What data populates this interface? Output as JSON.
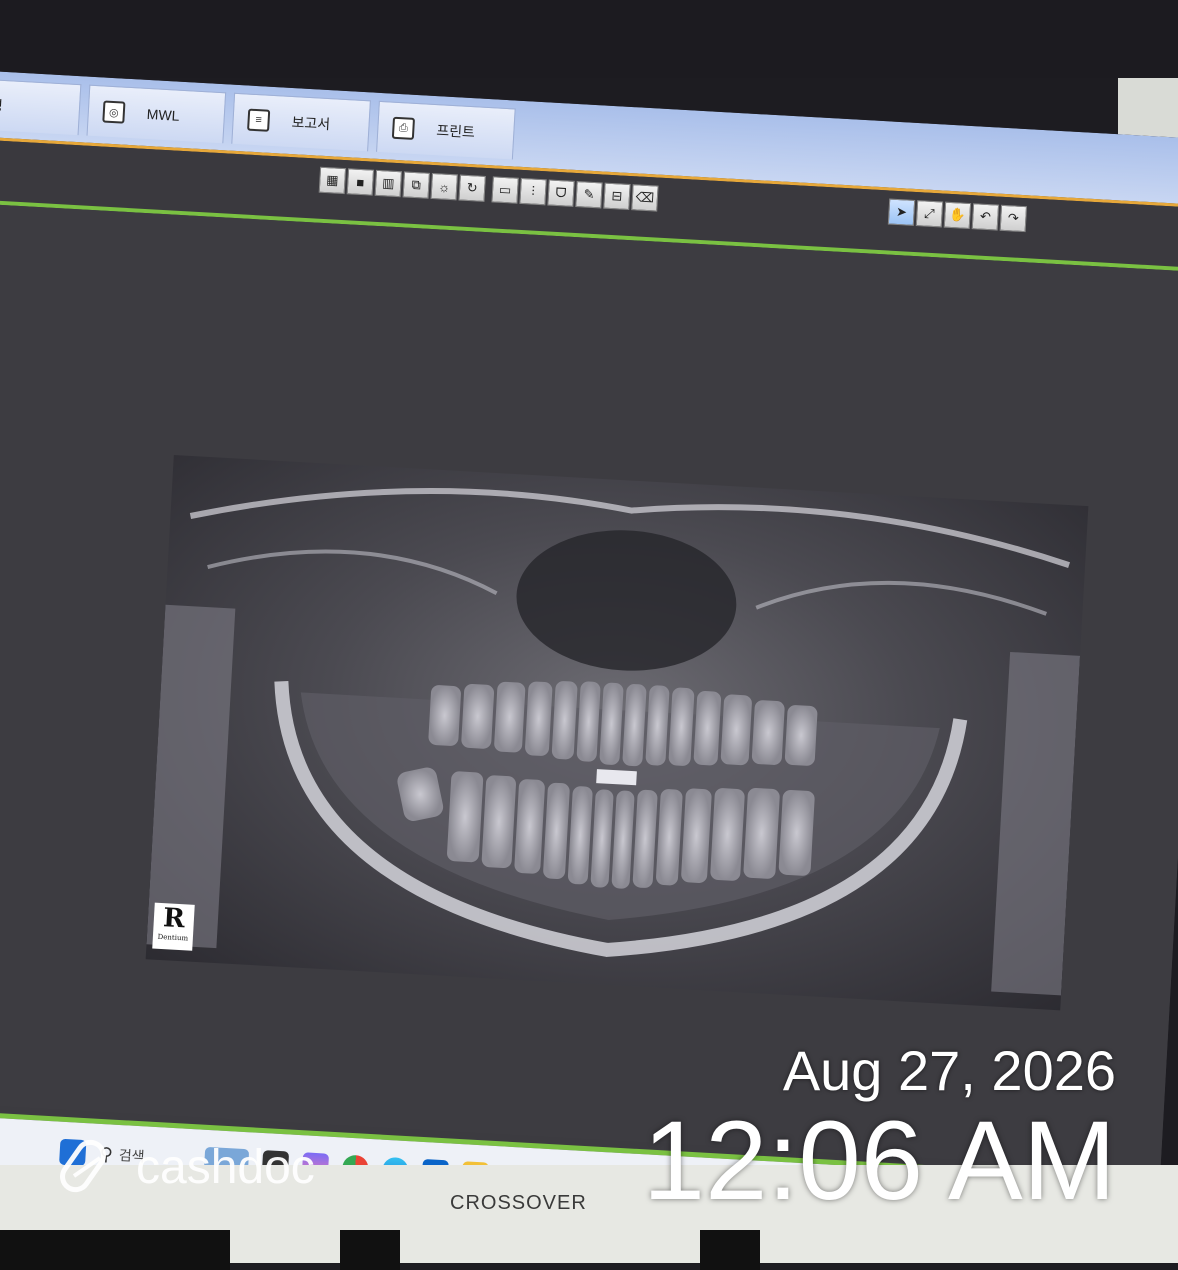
{
  "app": {
    "tabs": [
      {
        "label": "촬영",
        "icon": "camera-icon"
      },
      {
        "label": "MWL",
        "icon": "worklist-icon"
      },
      {
        "label": "보고서",
        "icon": "document-icon"
      },
      {
        "label": "프린트",
        "icon": "printer-icon"
      }
    ],
    "toolbar_left": [
      "grid-layout-icon",
      "single-view-icon",
      "dual-view-icon",
      "export-icon",
      "brightness-icon",
      "rotate-icon",
      "ruler-icon",
      "implant-icon",
      "tooth-icon",
      "pen-icon",
      "measure-icon",
      "eraser-icon"
    ],
    "toolbar_right": [
      "pointer-icon",
      "fit-icon",
      "pan-icon",
      "undo-icon",
      "redo-icon"
    ]
  },
  "image": {
    "type": "panoramic-dental-xray",
    "marker_letter": "R",
    "marker_sub": "Dentium"
  },
  "taskbar": {
    "search_label": "검색",
    "apps": [
      "windows-start-icon",
      "search-icon",
      "widget-icon",
      "file-icon",
      "copilot-icon",
      "chrome-icon",
      "edge-icon",
      "outlook-icon",
      "folder-icon",
      "app-icon"
    ]
  },
  "monitor": {
    "brand": "CROSSOVER"
  },
  "overlay": {
    "date": "Aug 27, 2026",
    "time": "12:06 AM",
    "watermark": "cashdoc"
  },
  "colors": {
    "ribbon": "#b8c9ee",
    "accent_orange": "#e7a83a",
    "accent_green": "#7ac142",
    "viewer_bg": "#3d3c41"
  }
}
